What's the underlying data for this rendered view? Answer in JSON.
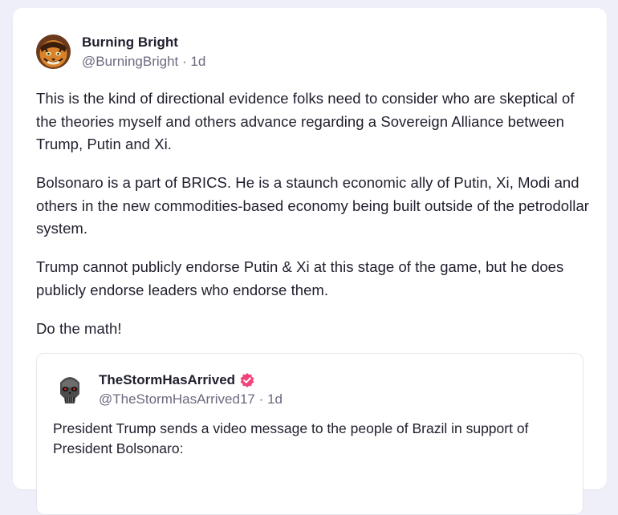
{
  "post": {
    "author": {
      "display_name": "Burning Bright",
      "handle": "@BurningBright",
      "time": "1d"
    },
    "paragraphs": [
      "This is the kind of directional evidence folks need to consider who are skeptical of the theories myself and others advance regarding a Sovereign Alliance between Trump, Putin and Xi.",
      "Bolsonaro is a part of BRICS. He is a staunch economic ally of Putin, Xi, Modi and others in the new commodities-based economy being built outside of the petrodollar system.",
      "Trump cannot publicly endorse Putin & Xi at this stage of the game, but he does publicly endorse leaders who endorse them.",
      "Do the math!"
    ]
  },
  "quoted_post": {
    "author": {
      "display_name": "TheStormHasArrived",
      "handle": "@TheStormHasArrived17",
      "time": "1d",
      "verified_color": "#f0457a"
    },
    "text": "President Trump sends a video message to the people of Brazil in support of President Bolsonaro:"
  },
  "separator": "·",
  "icons": {
    "author_avatar": "tiger-avatar-icon",
    "quote_avatar": "punisher-skull-avatar-icon",
    "verified": "verified-badge-icon"
  }
}
